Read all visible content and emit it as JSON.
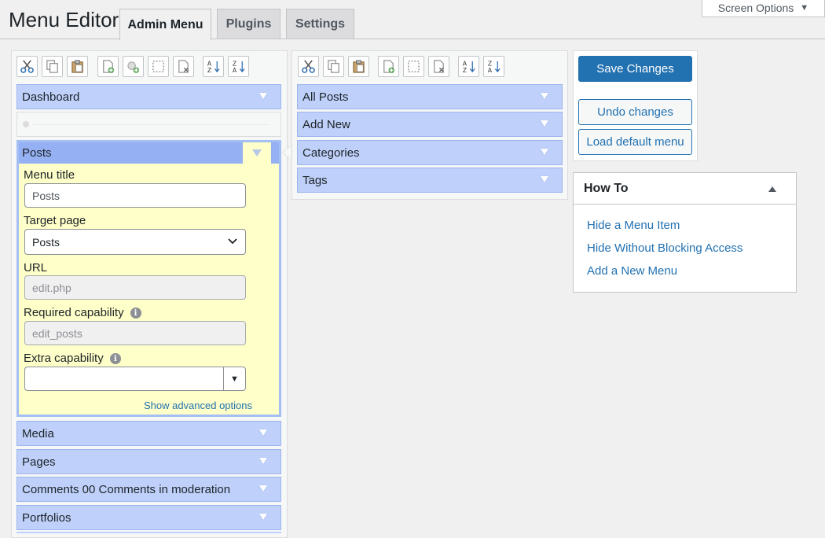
{
  "header": {
    "page_title": "Menu Editor",
    "tabs": [
      {
        "label": "Admin Menu",
        "active": true
      },
      {
        "label": "Plugins",
        "active": false
      },
      {
        "label": "Settings",
        "active": false
      }
    ],
    "screen_options": "Screen Options"
  },
  "left_column": {
    "toolbar": [
      "cut-icon",
      "copy-icon",
      "paste-icon",
      "new-menu-icon",
      "new-separator-icon",
      "toggle-hidden-icon",
      "delete-icon",
      "sort-ascending-icon",
      "sort-descending-icon"
    ],
    "items_above": [
      {
        "label": "Dashboard"
      }
    ],
    "selected": {
      "title": "Posts",
      "menu_title_label": "Menu title",
      "menu_title_placeholder": "Posts",
      "target_page_label": "Target page",
      "target_page_value": "Posts",
      "url_label": "URL",
      "url_value": "edit.php",
      "required_capability_label": "Required capability",
      "required_capability_value": "edit_posts",
      "extra_capability_label": "Extra capability",
      "extra_capability_value": "",
      "advanced_link": "Show advanced options"
    },
    "items_below": [
      {
        "label": "Media"
      },
      {
        "label": "Pages"
      },
      {
        "label": "Comments 00 Comments in moderation"
      },
      {
        "label": "Portfolios"
      }
    ]
  },
  "mid_column": {
    "toolbar": [
      "cut-icon",
      "copy-icon",
      "paste-icon",
      "new-menu-icon",
      "toggle-hidden-icon",
      "delete-icon",
      "sort-ascending-icon",
      "sort-descending-icon"
    ],
    "items": [
      {
        "label": "All Posts"
      },
      {
        "label": "Add New"
      },
      {
        "label": "Categories"
      },
      {
        "label": "Tags"
      }
    ]
  },
  "actions": {
    "save": "Save Changes",
    "undo": "Undo changes",
    "load_default": "Load default menu"
  },
  "howto": {
    "title": "How To",
    "links": [
      "Hide a Menu Item",
      "Hide Without Blocking Access",
      "Add a New Menu"
    ]
  },
  "colors": {
    "item_bg": "#bfd1fb",
    "selected_header": "#95b1f3",
    "editor_bg": "#ffffc9",
    "primary": "#2271b1"
  }
}
